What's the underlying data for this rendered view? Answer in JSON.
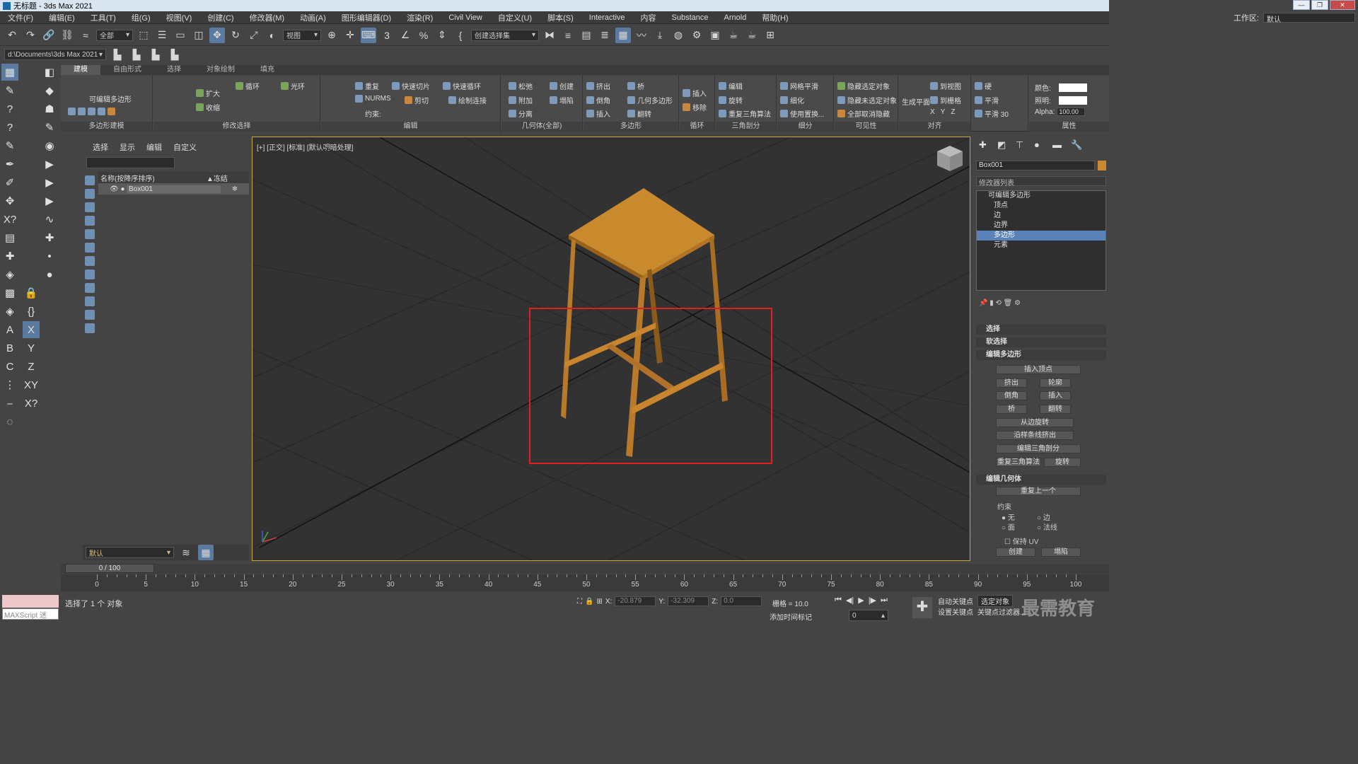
{
  "window": {
    "title": "无标题 - 3ds Max 2021"
  },
  "menu": [
    "文件(F)",
    "编辑(E)",
    "工具(T)",
    "组(G)",
    "视图(V)",
    "创建(C)",
    "修改器(M)",
    "动画(A)",
    "图形编辑器(D)",
    "渲染(R)",
    "Civil View",
    "自定义(U)",
    "脚本(S)",
    "Interactive",
    "内容",
    "Substance",
    "Arnold",
    "帮助(H)"
  ],
  "workspace": {
    "label": "工作区:",
    "value": "默认"
  },
  "toolbar": {
    "selection_filter": "全部",
    "ref_coord": "视图",
    "named_selection": "创建选择集"
  },
  "project_path": "d:\\Documents\\3ds Max 2021",
  "ribbon": {
    "tabs": [
      "建模",
      "自由形式",
      "选择",
      "对象绘制",
      "填充"
    ],
    "active_tab": "建模",
    "groups": {
      "poly_modeling": {
        "title": "多边形建模",
        "label": "可编辑多边形"
      },
      "modify_selection": {
        "title": "修改选择",
        "items": [
          "扩大",
          "收缩",
          "循环",
          "光环"
        ]
      },
      "edit": {
        "title": "编辑",
        "items": [
          "重复",
          "快速切片",
          "快速循环",
          "NURMS",
          "剪切",
          "绘制连接"
        ],
        "constraint": "约束:"
      },
      "geometry": {
        "title": "几何体(全部)",
        "items": [
          "松弛",
          "创建",
          "附加",
          "塌陷",
          "分离"
        ]
      },
      "polygons": {
        "title": "多边形",
        "items": [
          "挤出",
          "桥",
          "倒角",
          "几何多边形",
          "插入",
          "翻转"
        ]
      },
      "loops": {
        "title": "循环",
        "items": [
          "插入",
          "移除"
        ]
      },
      "tris": {
        "title": "三角剖分",
        "items": [
          "编辑",
          "旋转",
          "重复三角算法"
        ]
      },
      "subdivision": {
        "title": "细分",
        "items": [
          "网格平滑",
          "细化",
          "使用置换..."
        ]
      },
      "visibility": {
        "title": "可见性",
        "items": [
          "隐藏选定对象",
          "隐藏未选定对象",
          "全部取消隐藏"
        ]
      },
      "align": {
        "title": "对齐",
        "items": [
          "生成平面",
          "到视图",
          "到栅格",
          "X",
          "Y",
          "Z"
        ]
      },
      "properties": {
        "title": "属性",
        "items": [
          "硬",
          "平滑",
          "平滑 30"
        ],
        "color_label": "颜色:",
        "illum_label": "照明:",
        "alpha_label": "Alpha:",
        "alpha_value": "100.00"
      }
    }
  },
  "scene_explorer": {
    "tabs": [
      "选择",
      "显示",
      "编辑",
      "自定义"
    ],
    "col_name": "名称(按降序排序)",
    "col_freeze": "▲冻结",
    "rows": [
      {
        "name": "Box001"
      }
    ],
    "layer": "默认"
  },
  "viewport": {
    "label": "[+] [正交] [标准] [默认明暗处理]"
  },
  "command_panel": {
    "object_name": "Box001",
    "modifier_list": "修改器列表",
    "stack": [
      {
        "label": "可编辑多边形",
        "top": true
      },
      {
        "label": "顶点"
      },
      {
        "label": "边"
      },
      {
        "label": "边界"
      },
      {
        "label": "多边形",
        "selected": true
      },
      {
        "label": "元素"
      }
    ],
    "rollouts": {
      "select": "选择",
      "soft_select": "软选择",
      "edit_poly": "编辑多边形",
      "edit_geom": "编辑几何体"
    },
    "edit_poly_buttons": [
      "插入顶点",
      "挤出",
      "轮廓",
      "倒角",
      "插入",
      "桥",
      "翻转",
      "从边旋转",
      "沿样条线挤出",
      "编辑三角剖分",
      "重复三角算法",
      "旋转"
    ],
    "edit_geom": {
      "repeat_last": "重复上一个",
      "constraint": "约束",
      "options": [
        "无",
        "边",
        "面",
        "法线"
      ],
      "keep_uv": "保持 UV",
      "create": "创建",
      "collapse": "塌陷"
    }
  },
  "timeline": {
    "slider": "0 / 100",
    "ticks": [
      "0",
      "5",
      "10",
      "15",
      "20",
      "25",
      "30",
      "35",
      "40",
      "45",
      "50",
      "55",
      "60",
      "65",
      "70",
      "75",
      "80",
      "85",
      "90",
      "95",
      "100"
    ]
  },
  "status": {
    "maxscript": "MAXScript 迷",
    "message": "选择了 1 个 对象",
    "x_label": "X:",
    "x": "-20.879",
    "y_label": "Y:",
    "y": "-32.309",
    "z_label": "Z:",
    "z": "0.0",
    "grid": "栅格 = 10.0",
    "add_time_tag": "添加时间标记",
    "auto_key": "自动关键点",
    "selected": "选定对象",
    "set_key": "设置关键点",
    "key_filters": "关键点过滤器...",
    "frame": "0",
    "watermark": "最需教育"
  },
  "colors": {
    "accent": "#5a82b8",
    "stool": "#c98a2e",
    "highlight_box": "#e02020",
    "viewport_border": "#c9a843"
  }
}
